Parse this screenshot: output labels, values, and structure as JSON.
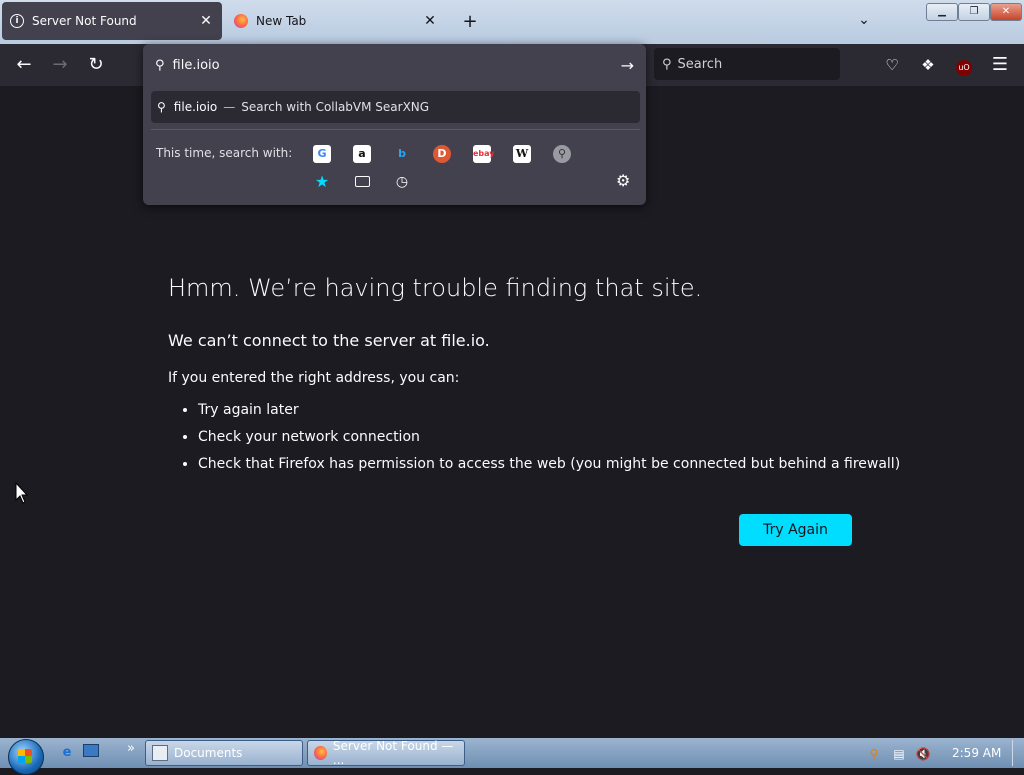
{
  "tabs": [
    {
      "label": "Server Not Found",
      "active": true
    },
    {
      "label": "New Tab",
      "active": false
    }
  ],
  "urlbar": {
    "value": "file.ioio",
    "suggestion_text": "file.ioio",
    "suggestion_separator": "—",
    "suggestion_engine": "Search with CollabVM SearXNG",
    "oneoff_label": "This time, search with:",
    "engines": [
      "google-icon",
      "amazon-icon",
      "bing-icon",
      "duckduckgo-icon",
      "ebay-icon",
      "wikipedia-icon",
      "searxng-icon"
    ],
    "modes": [
      "bookmarks-icon",
      "tabs-icon",
      "history-icon"
    ]
  },
  "search": {
    "placeholder": "Search"
  },
  "error": {
    "title": "Hmm. We’re having trouble finding that site.",
    "subtitle": "We can’t connect to the server at file.io.",
    "hint": "If you entered the right address, you can:",
    "items": [
      "Try again later",
      "Check your network connection",
      "Check that Firefox has permission to access the web (you might be connected but behind a firewall)"
    ],
    "button": "Try Again"
  },
  "taskbar": {
    "buttons": [
      {
        "label": "Documents"
      },
      {
        "label": "Server Not Found — ..."
      }
    ],
    "clock": "2:59 AM",
    "overflow": "»"
  },
  "colors": {
    "page_bg": "#1c1b22",
    "accent": "#00ddff",
    "panel": "#42414d"
  }
}
